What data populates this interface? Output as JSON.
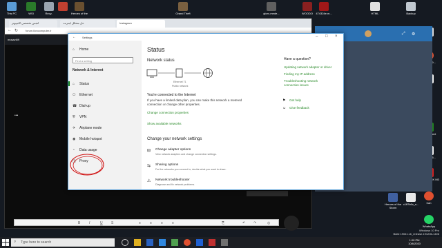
{
  "desktop_icons": [
    {
      "label": "This PC",
      "color": "#5a9bd5"
    },
    {
      "label": "WSI",
      "color": "#2a7a2a"
    },
    {
      "label": "Recy..",
      "color": "#9aa5b0"
    },
    {
      "label": "",
      "color": "#c04030"
    },
    {
      "label": "Heroes of the",
      "color": "#6a5030"
    },
    {
      "label": "Grand Theft",
      "color": "#7a6040"
    },
    {
      "label": "glorv-mede...",
      "color": "#606060"
    },
    {
      "label": "WOODO",
      "color": "#8a2020"
    },
    {
      "label": "474324e.m...",
      "color": "#a01818"
    },
    {
      "label": "HTML",
      "color": "#e0e0e0"
    },
    {
      "label": "Backup",
      "color": "#c0c8d0"
    }
  ],
  "right_icons": [
    {
      "label": "Bot",
      "color": "#d8d8d8"
    },
    {
      "label": "trollo-389...",
      "color": "#e05030"
    },
    {
      "label": "YU",
      "color": "#f0f0f0"
    },
    {
      "label": "RAMExpert",
      "color": "#208020"
    },
    {
      "label": "28697-16...",
      "color": "#eeeeee"
    },
    {
      "label": "PES CRACK M3",
      "color": "#d02020"
    },
    {
      "label": "Iran",
      "color": "#e05030"
    },
    {
      "label": "WhatsApp",
      "color": "#25d366"
    }
  ],
  "bottom_icons": [
    {
      "label": "Heroes of the Storm",
      "color": "#4060a0"
    },
    {
      "label": "c1ff7b6c_s...",
      "color": "#e8e8e8"
    }
  ],
  "browser": {
    "tabs": [
      "انجمن تخصصی کامپیوتر",
      "حل مشکل اینترنت",
      "Instagram"
    ],
    "address": "forum.iloncomputer.ir",
    "user": "mosavi09",
    "editor_icons": [
      "B",
      "I",
      "U",
      "S",
      "≡",
      "≡",
      "≡",
      "≡",
      "⎘",
      "↶",
      "↷",
      "◎"
    ]
  },
  "settings": {
    "window_title": "Settings",
    "sidebar": {
      "home": "Home",
      "search_placeholder": "Find a setting",
      "category": "Network & Internet",
      "items": [
        {
          "icon": "⌂",
          "label": "Status"
        },
        {
          "icon": "⎔",
          "label": "Ethernet"
        },
        {
          "icon": "☎",
          "label": "Dial-up"
        },
        {
          "icon": "⛨",
          "label": "VPN"
        },
        {
          "icon": "✈",
          "label": "Airplane mode"
        },
        {
          "icon": "◉",
          "label": "Mobile hotspot"
        },
        {
          "icon": "◔",
          "label": "Data usage"
        },
        {
          "icon": "◫",
          "label": "Proxy"
        }
      ]
    },
    "main": {
      "title": "Status",
      "network_status": "Network status",
      "adapter": "Ethernet 71",
      "network_type": "Public network",
      "connected": "You're connected to the Internet",
      "metered_text": "If you have a limited data plan, you can make this network a metered connection or change other properties.",
      "change_props": "Change connection properties",
      "show_networks": "Show available networks",
      "change_settings": "Change your network settings",
      "options": [
        {
          "title": "Change adapter options",
          "desc": "View network adapters and change connection settings."
        },
        {
          "title": "Sharing options",
          "desc": "For the networks you connect to, decide what you want to share."
        },
        {
          "title": "Network troubleshooter",
          "desc": "Diagnose and fix network problems."
        }
      ]
    },
    "right": {
      "question": "Have a question?",
      "links": [
        "Updating network adapter or driver",
        "Finding my IP address",
        "Troubleshooting network connection issues"
      ],
      "help": "Get help",
      "feedback": "Give feedback"
    }
  },
  "taskbar": {
    "search": "Type here to search",
    "time": "1:00 PM",
    "date": "10/6/2020"
  },
  "watermark": {
    "line1": "Windows 10 Pro",
    "line2": "Build 19041.vb_release.191206-1406"
  }
}
